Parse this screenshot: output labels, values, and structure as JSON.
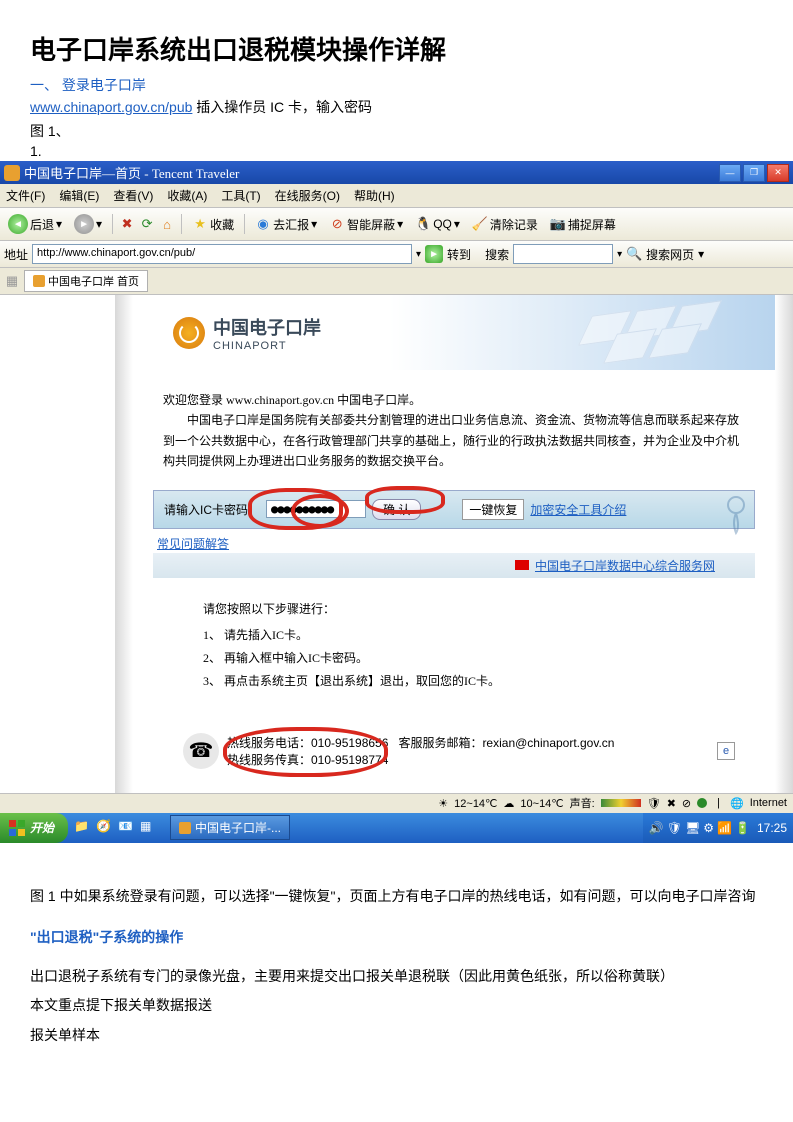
{
  "title": "电子口岸系统出口退税模块操作详解",
  "section1": "一、 登录电子口岸",
  "url": "www.chinaport.gov.cn/pub",
  "url_after": "  插入操作员 IC 卡，输入密码",
  "fig1": "图 1、",
  "fig1n": "1.",
  "browser": {
    "title": "中国电子口岸—首页 - Tencent Traveler",
    "menu": [
      "文件(F)",
      "编辑(E)",
      "查看(V)",
      "收藏(A)",
      "工具(T)",
      "在线服务(O)",
      "帮助(H)"
    ],
    "back": "后退",
    "fav": "收藏",
    "huibao": "去汇报",
    "zhineng": "智能屏蔽",
    "qq": "QQ",
    "clear": "清除记录",
    "cap": "捕捉屏幕",
    "addr_label": "地址",
    "addr": "http://www.chinaport.gov.cn/pub/",
    "goto": "转到",
    "search": "搜索",
    "search_page": "搜索网页",
    "tab": "中国电子口岸 首页"
  },
  "page": {
    "logo1": "中国电子口岸",
    "logo2": "CHINAPORT",
    "welcome": "欢迎您登录 www.chinaport.gov.cn 中国电子口岸。",
    "desc": "中国电子口岸是国务院有关部委共分割管理的进出口业务信息流、资金流、货物流等信息而联系起来存放到一个公共数据中心，在各行政管理部门共享的基础上，随行业的行政执法数据共同核查，并为企业及中介机构共同提供网上办理进出口业务服务的数据交换平台。",
    "pw_label": "请输入IC卡密码：",
    "pw": "●●●●●●●●●●",
    "ok": "确 认",
    "faq": "常见问题解答",
    "restore": "一键恢复",
    "enc_intro": "加密安全工具介绍",
    "dc_link": "中国电子口岸数据中心综合服务网",
    "steps_h": "请您按照以下步骤进行：",
    "step1": "1、 请先插入IC卡。",
    "step2": "2、 再输入框中输入IC卡密码。",
    "step3": "3、 再点击系统主页【退出系统】退出，取回您的IC卡。",
    "hot1": "热线服务电话：010-95198656",
    "hot2": "热线服务传真：010-95198774",
    "hot_mail": "客服服务邮箱：rexian@chinaport.gov.cn"
  },
  "status": {
    "temp1": "12~14℃",
    "temp2": "10~14℃",
    "sound": "声音:",
    "internet": "Internet"
  },
  "taskbar": {
    "start": "开始",
    "task1": "中国电子口岸-...",
    "time": "17:25"
  },
  "caption1": "图 1 中如果系统登录有问题，可以选择\"一键恢复\"，页面上方有电子口岸的热线电话，如有问题，可以向电子口岸咨询",
  "sub_heading": "\"出口退税\"子系统的操作",
  "para1": "出口退税子系统有专门的录像光盘，主要用来提交出口报关单退税联（因此用黄色纸张，所以俗称黄联）",
  "para2": "本文重点提下报关单数据报送",
  "para3": "报关单样本"
}
